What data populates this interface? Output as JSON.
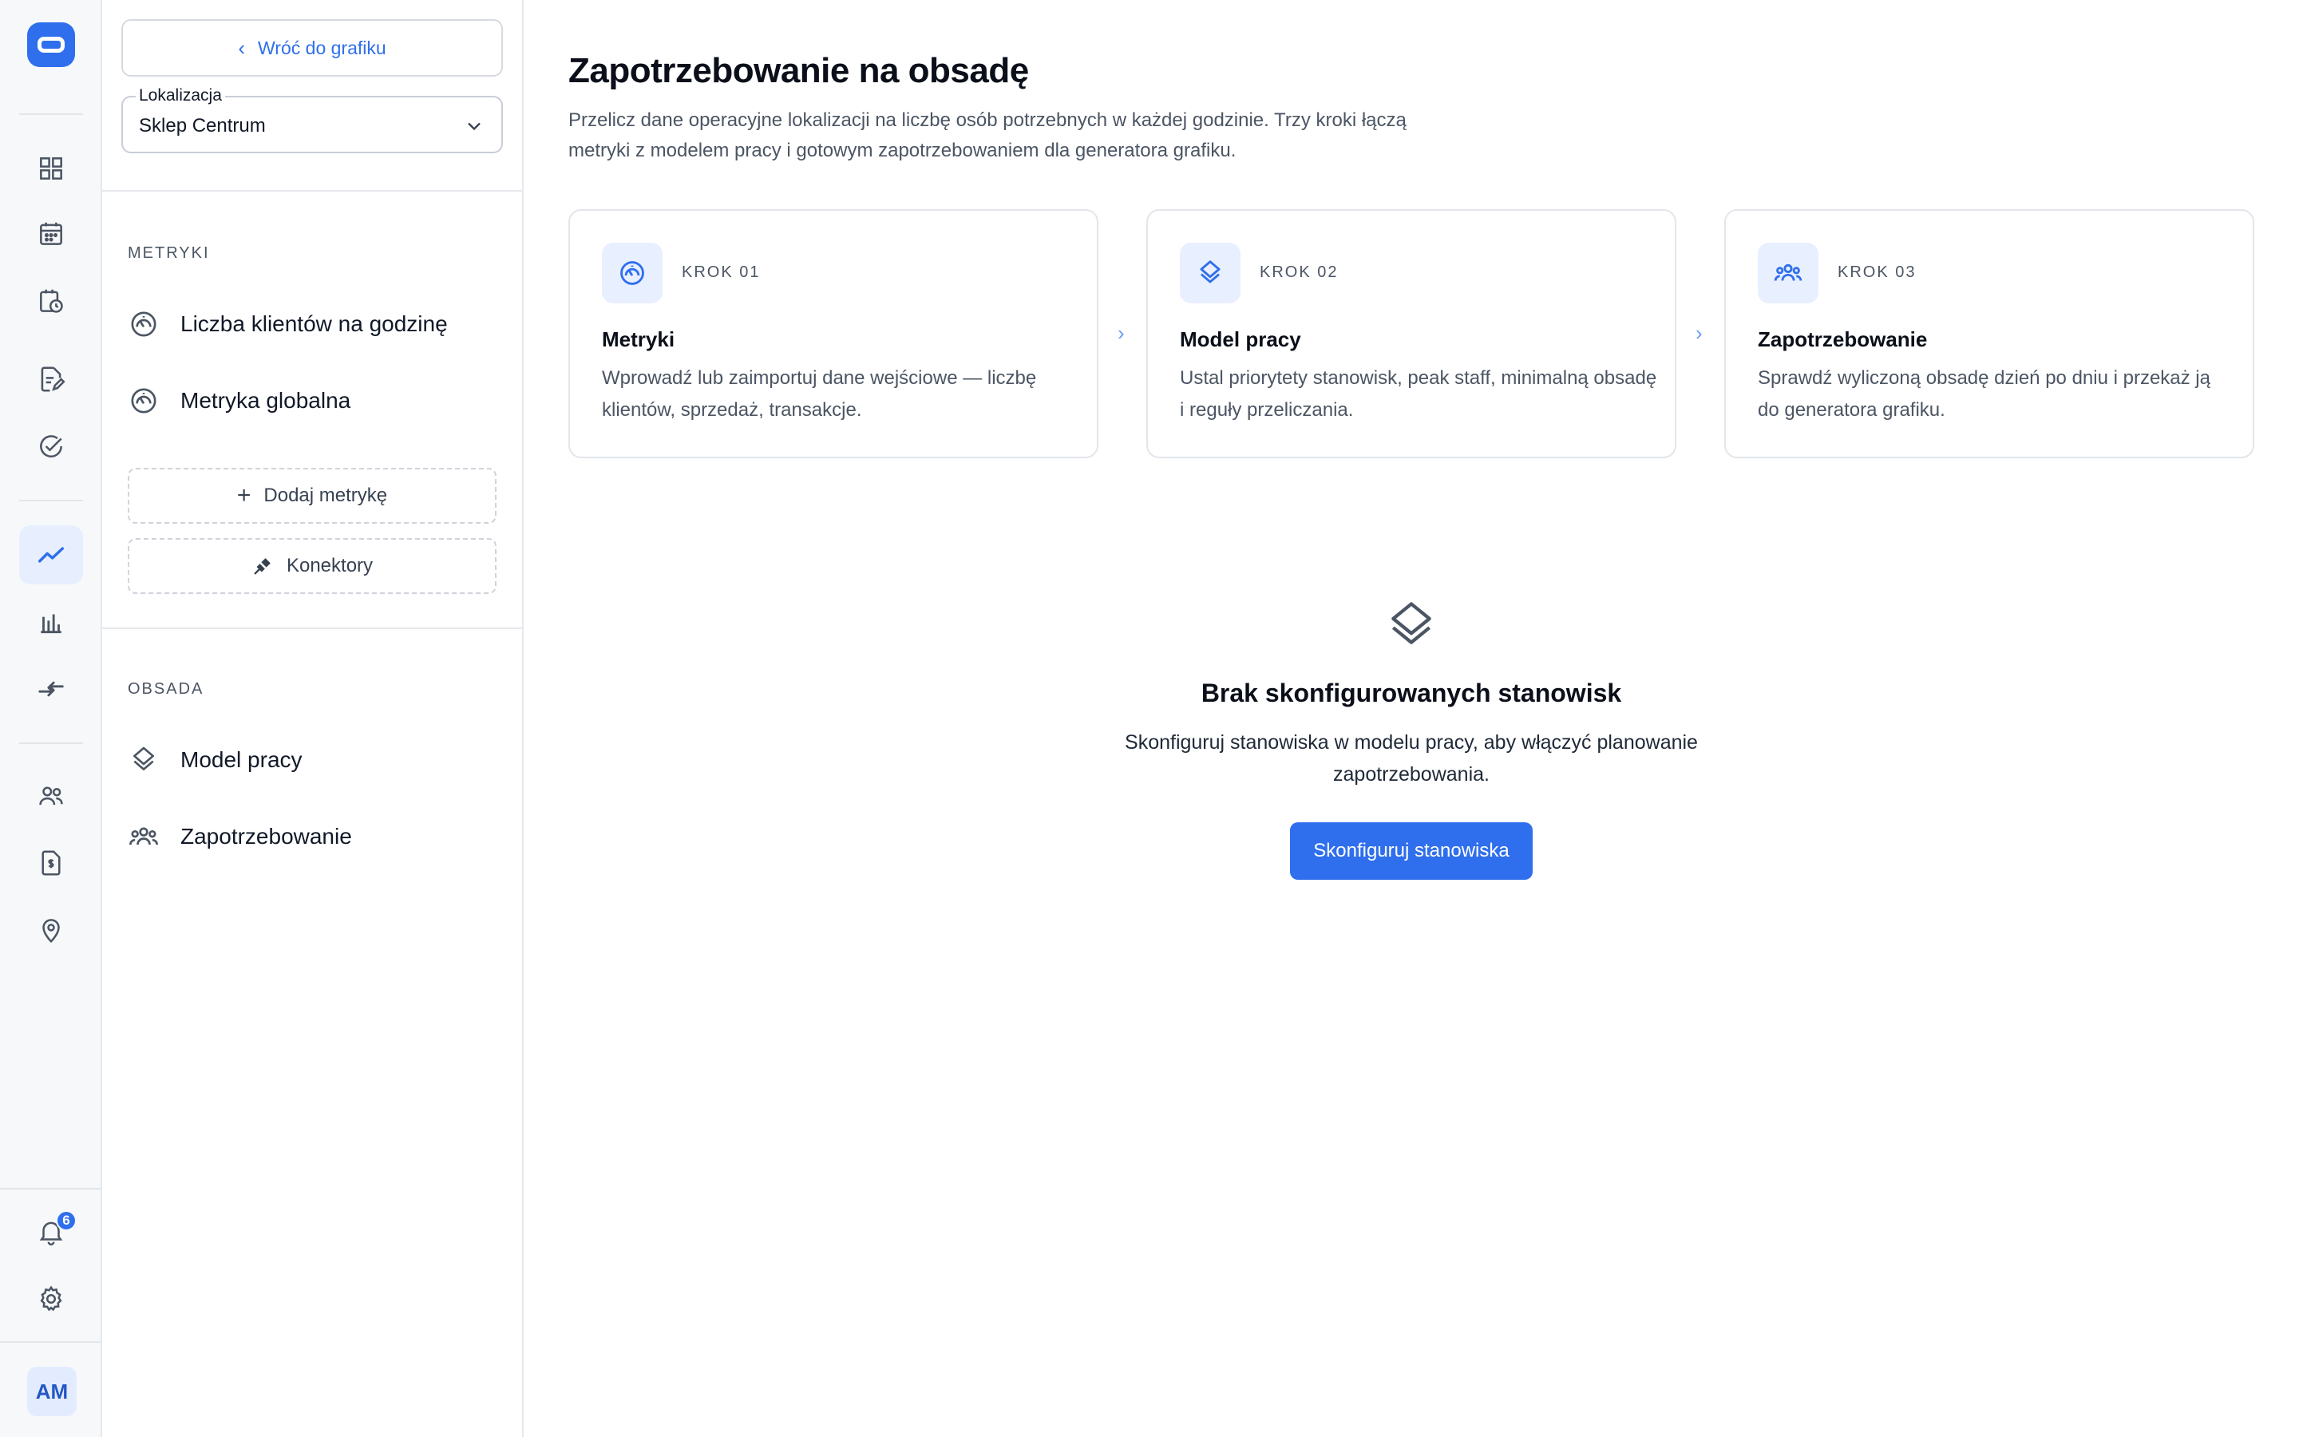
{
  "rail": {
    "icons": [
      "app-logo-icon",
      "dashboard-icon",
      "calendar-icon",
      "schedule-clock-icon",
      "document-edit-icon",
      "check-circle-icon",
      "trend-line-icon",
      "bar-chart-icon",
      "swap-icon",
      "people-icon",
      "payroll-icon",
      "location-pin-icon",
      "bell-icon",
      "gear-icon"
    ],
    "notification_count": "6",
    "avatar_initials": "AM",
    "accent": "#2f6fed"
  },
  "sidebar": {
    "back_label": "Wróć do grafiku",
    "location": {
      "label": "Lokalizacja",
      "value": "Sklep Centrum"
    },
    "metrics_section": "METRYKI",
    "metrics": [
      {
        "label": "Liczba klientów na godzinę",
        "icon": "gauge-icon"
      },
      {
        "label": "Metryka globalna",
        "icon": "gauge-icon"
      }
    ],
    "add_metric": "Dodaj metrykę",
    "connectors": "Konektory",
    "staffing_section": "OBSADA",
    "staffing": [
      {
        "label": "Model pracy",
        "icon": "layers-icon"
      },
      {
        "label": "Zapotrzebowanie",
        "icon": "people-icon"
      }
    ]
  },
  "main": {
    "title": "Zapotrzebowanie na obsadę",
    "subtitle": "Przelicz dane operacyjne lokalizacji na liczbę osób potrzebnych w każdej godzinie. Trzy kroki łączą metryki z modelem pracy i gotowym zapotrzebowaniem dla generatora grafiku.",
    "steps": [
      {
        "kicker": "KROK 01",
        "title": "Metryki",
        "desc": "Wprowadź lub zaimportuj dane wejściowe — liczbę klientów, sprzedaż, transakcje.",
        "icon": "gauge-icon"
      },
      {
        "kicker": "KROK 02",
        "title": "Model pracy",
        "desc": "Ustal priorytety stanowisk, peak staff, minimalną obsadę i reguły przeliczania.",
        "icon": "layers-icon"
      },
      {
        "kicker": "KROK 03",
        "title": "Zapotrzebowanie",
        "desc": "Sprawdź wyliczoną obsadę dzień po dniu i przekaż ją do generatora grafiku.",
        "icon": "people-icon"
      }
    ],
    "empty": {
      "icon": "layers-icon",
      "title": "Brak skonfigurowanych stanowisk",
      "desc": "Skonfiguruj stanowiska w modelu pracy, aby włączyć planowanie zapotrzebowania.",
      "cta": "Skonfiguruj stanowiska"
    }
  }
}
